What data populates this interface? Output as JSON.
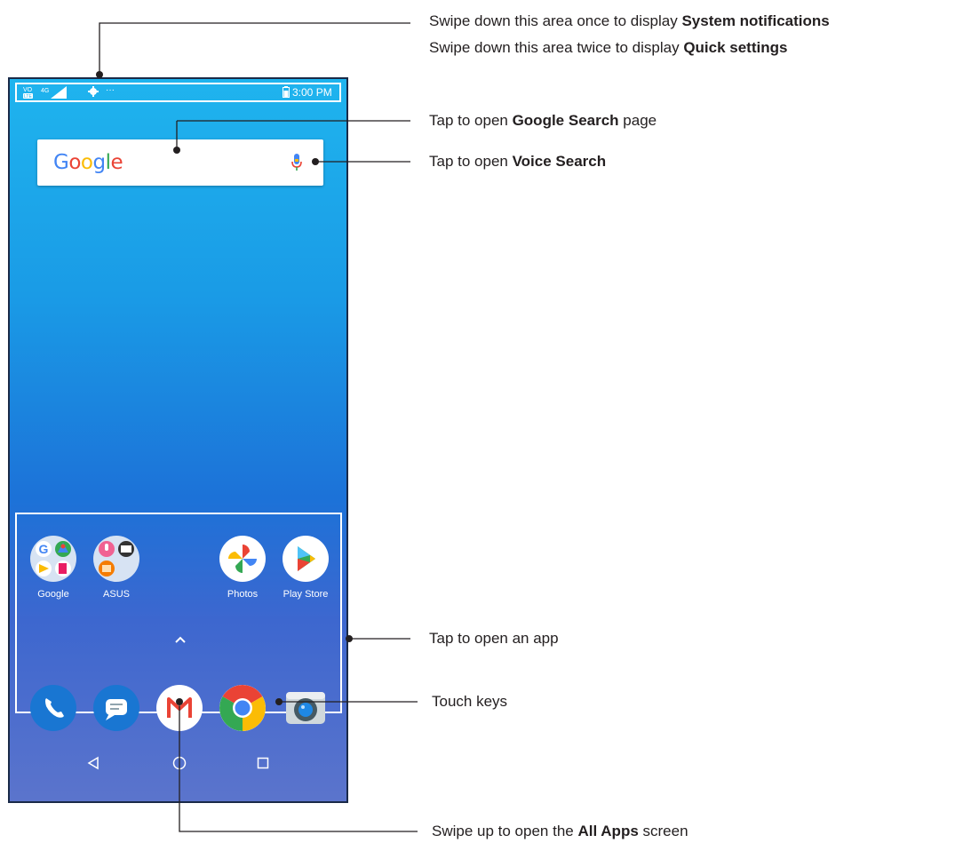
{
  "status_bar": {
    "network_left": "VoLTE",
    "network_type": "4G",
    "overflow": "···",
    "time": "3:00 PM"
  },
  "search_widget": {
    "logo": "Google"
  },
  "home_apps": [
    {
      "label": "Google",
      "icon": "google-folder-icon"
    },
    {
      "label": "ASUS",
      "icon": "asus-folder-icon"
    },
    {
      "label": "Photos",
      "icon": "photos-icon"
    },
    {
      "label": "Play Store",
      "icon": "play-store-icon"
    }
  ],
  "dock_apps": [
    {
      "icon": "phone-icon"
    },
    {
      "icon": "messages-icon"
    },
    {
      "icon": "gmail-icon"
    },
    {
      "icon": "chrome-icon"
    },
    {
      "icon": "camera-icon"
    }
  ],
  "nav_keys": [
    "back-icon",
    "home-icon",
    "recents-icon"
  ],
  "callouts": {
    "status": {
      "line1_pre": "Swipe down this area once to display ",
      "line1_bold": "System notifications",
      "line2_pre": "Swipe down this area twice to display ",
      "line2_bold": "Quick settings"
    },
    "google_search": {
      "pre": "Tap to open ",
      "bold": "Google Search",
      "post": " page"
    },
    "voice_search": {
      "pre": "Tap to open ",
      "bold": "Voice Search"
    },
    "open_app": {
      "text": "Tap to open an app"
    },
    "touch_keys": {
      "text": "Touch keys"
    },
    "all_apps": {
      "pre": "Swipe up to open the ",
      "bold": "All Apps",
      "post": " screen"
    }
  },
  "colors": {
    "callout_line": "#231f20",
    "google_blue": "#4285F4",
    "google_red": "#EA4335",
    "google_yellow": "#FBBC05",
    "google_green": "#34A853"
  }
}
